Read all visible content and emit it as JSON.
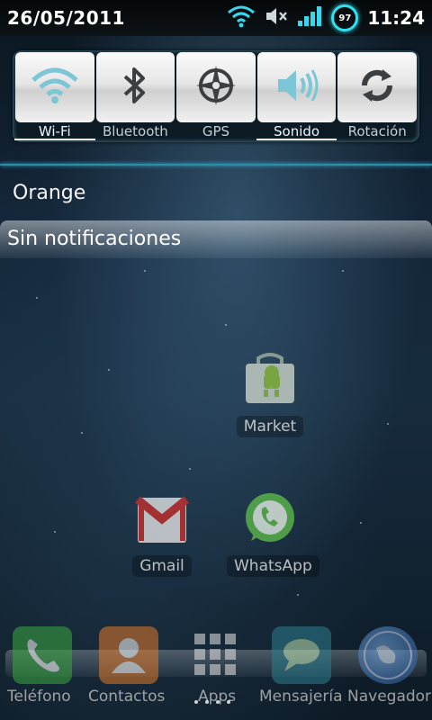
{
  "status_bar": {
    "date": "26/05/2011",
    "battery_level": "97",
    "time": "11:24",
    "icons": [
      "wifi-icon",
      "muted-speaker-icon",
      "signal-icon",
      "battery-ring-icon"
    ]
  },
  "quick_settings": {
    "toggles": [
      {
        "label": "Wi-Fi",
        "icon": "wifi-icon",
        "state": "on"
      },
      {
        "label": "Bluetooth",
        "icon": "bluetooth-icon",
        "state": "off"
      },
      {
        "label": "GPS",
        "icon": "gps-icon",
        "state": "off"
      },
      {
        "label": "Sonido",
        "icon": "speaker-icon",
        "state": "on"
      },
      {
        "label": "Rotación",
        "icon": "rotation-icon",
        "state": "off"
      }
    ]
  },
  "carrier": "Orange",
  "notifications": {
    "empty_text": "Sin notificaciones"
  },
  "desktop": {
    "apps": [
      {
        "label": "Market",
        "icon": "market-bag-icon"
      },
      {
        "label": "Gmail",
        "icon": "gmail-icon"
      },
      {
        "label": "WhatsApp",
        "icon": "whatsapp-icon"
      }
    ]
  },
  "dock": {
    "items": [
      {
        "label": "Teléfono",
        "icon": "phone-icon"
      },
      {
        "label": "Contactos",
        "icon": "contacts-icon"
      },
      {
        "label": "Apps",
        "icon": "app-grid-icon"
      },
      {
        "label": "Mensajería",
        "icon": "messaging-icon"
      },
      {
        "label": "Navegador",
        "icon": "globe-icon"
      }
    ]
  },
  "colors": {
    "accent": "#2fe1f0",
    "divider": "#2b8ea6"
  }
}
